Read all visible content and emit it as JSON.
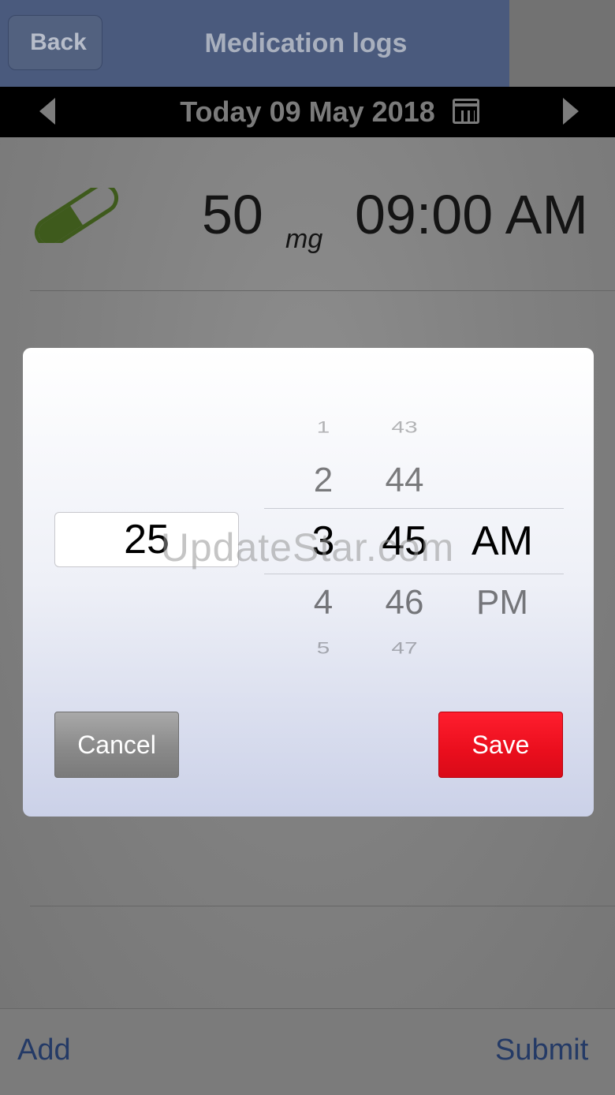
{
  "nav": {
    "back_label": "Back",
    "title": "Medication logs"
  },
  "date_bar": {
    "date_text": "Today 09 May 2018",
    "calendar_icon": "calendar-icon",
    "prev_icon": "triangle-left-icon",
    "next_icon": "triangle-right-icon"
  },
  "log_entry": {
    "icon": "pill-icon",
    "pill_color": "#3e5a1c",
    "dose": "50",
    "unit": "mg",
    "time": "09:00 AM"
  },
  "dialog": {
    "quantity_value": "25",
    "picker": {
      "hours": [
        "1",
        "2",
        "3",
        "4",
        "5"
      ],
      "minutes": [
        "43",
        "44",
        "45",
        "46",
        "47"
      ],
      "ampm": [
        "AM",
        "PM"
      ]
    },
    "cancel_label": "Cancel",
    "save_label": "Save",
    "save_color": "#ea0e1d"
  },
  "bottom_bar": {
    "add_label": "Add",
    "submit_label": "Submit"
  },
  "watermark": "UpdateStar.com"
}
